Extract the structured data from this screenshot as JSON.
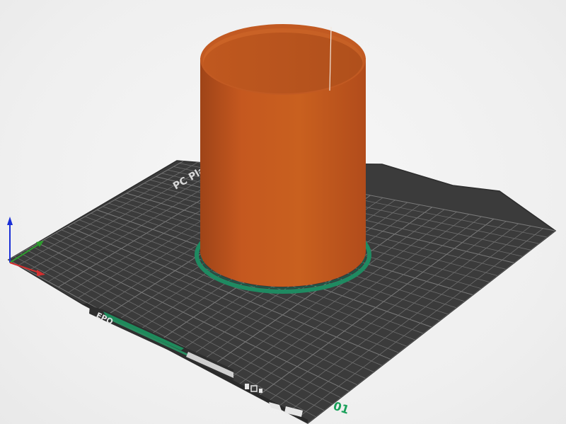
{
  "viewport": {
    "plate_label": "PC Plate",
    "plate_number": "01",
    "object_color": "#c75a23",
    "bed_color": "#3b3b3b",
    "grid_color": "#6a6a6a",
    "accent_color": "#1f8a61",
    "axis_colors": {
      "x": "#d32f2f",
      "y": "#2e9d2e",
      "z": "#1a2fd6"
    }
  },
  "icons": {
    "axes": "xyz-axes-icon",
    "bed_logo": "bed-logo-icon",
    "object": "cylinder-object",
    "skirt": "skirt-outline"
  }
}
